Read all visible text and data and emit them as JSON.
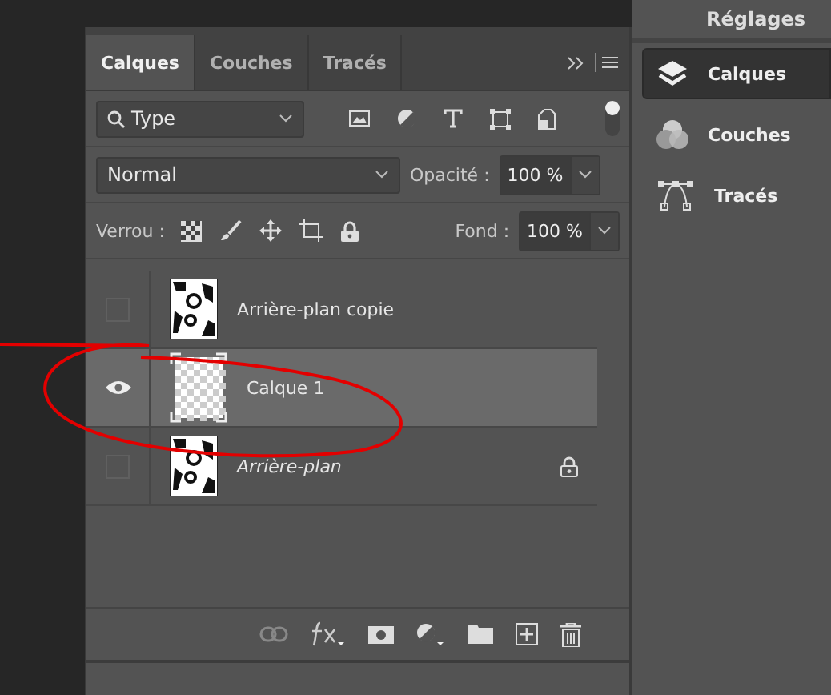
{
  "panel": {
    "tabs": [
      {
        "label": "Calques",
        "selected": true
      },
      {
        "label": "Couches",
        "selected": false
      },
      {
        "label": "Tracés",
        "selected": false
      }
    ],
    "filter": {
      "value": "Type",
      "toggle_on": true
    },
    "blend": {
      "mode": "Normal",
      "opacity_label": "Opacité :",
      "opacity": "100 %"
    },
    "lock": {
      "label": "Verrou :",
      "fill_label": "Fond :",
      "fill": "100 %"
    },
    "layers": [
      {
        "name": "Arrière-plan copie",
        "visible": false,
        "selected": false,
        "kind": "image",
        "italic": false,
        "locked": false
      },
      {
        "name": "Calque 1",
        "visible": true,
        "selected": true,
        "kind": "transparent",
        "italic": false,
        "locked": false
      },
      {
        "name": "Arrière-plan",
        "visible": false,
        "selected": false,
        "kind": "image",
        "italic": true,
        "locked": true
      }
    ]
  },
  "dock": {
    "header": "Réglages",
    "items": [
      {
        "label": "Calques",
        "kind": "layers",
        "selected": true
      },
      {
        "label": "Couches",
        "kind": "channels",
        "selected": false
      },
      {
        "label": "Tracés",
        "kind": "paths",
        "selected": false
      }
    ]
  }
}
